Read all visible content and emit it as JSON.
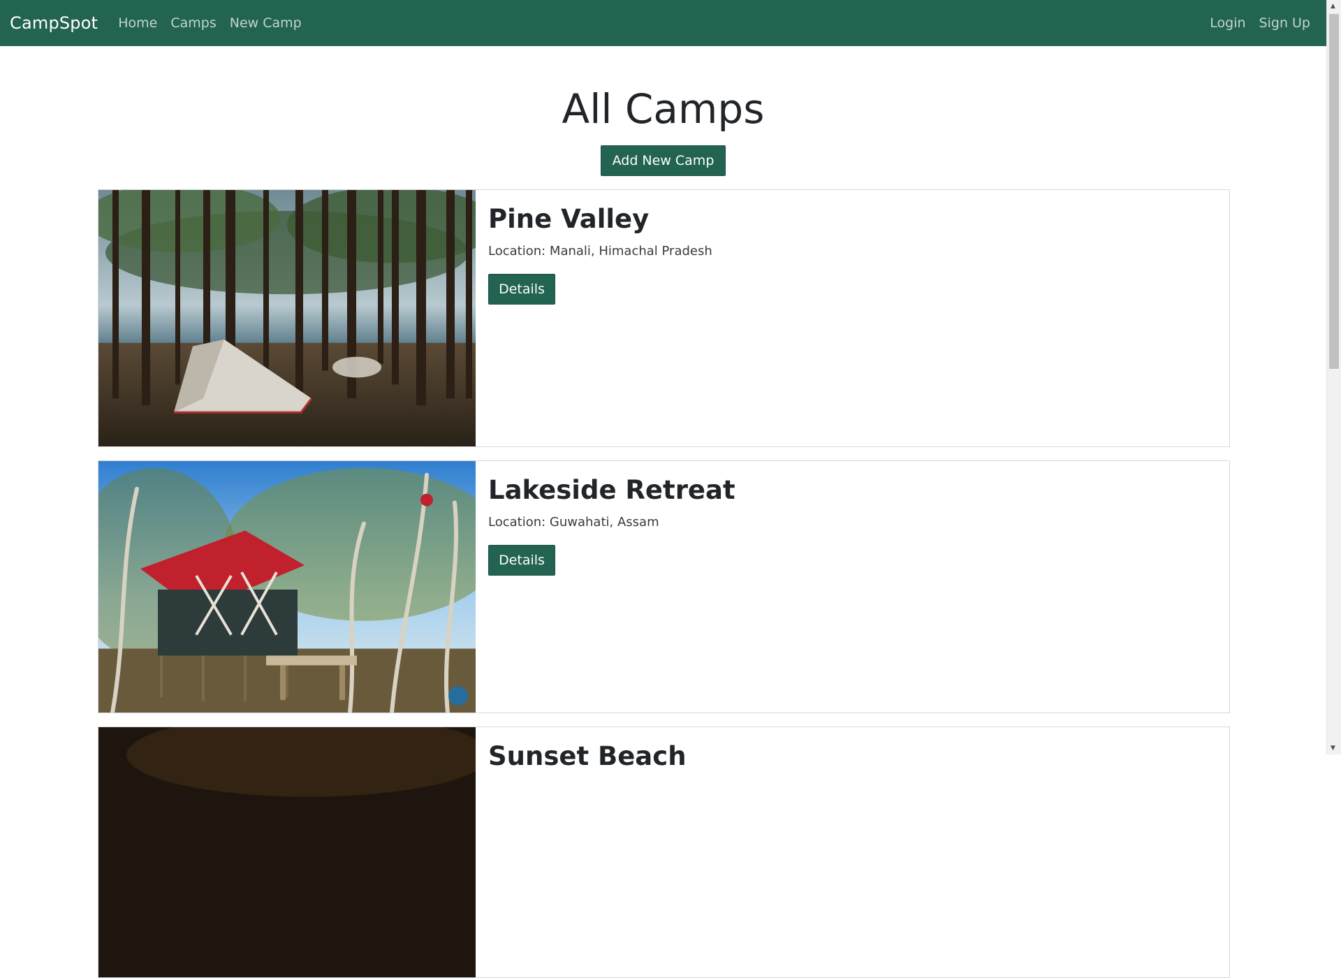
{
  "navbar": {
    "brand": "CampSpot",
    "links": [
      "Home",
      "Camps",
      "New Camp"
    ],
    "auth_links": [
      "Login",
      "Sign Up"
    ]
  },
  "page": {
    "title": "All Camps",
    "add_button": "Add New Camp"
  },
  "camps": [
    {
      "title": "Pine Valley",
      "location": "Location: Manali, Himachal Pradesh",
      "details_label": "Details"
    },
    {
      "title": "Lakeside Retreat",
      "location": "Location: Guwahati, Assam",
      "details_label": "Details"
    },
    {
      "title": "Sunset Beach",
      "location": "",
      "details_label": ""
    }
  ],
  "colors": {
    "navbar": "#226352",
    "button": "#226352"
  }
}
